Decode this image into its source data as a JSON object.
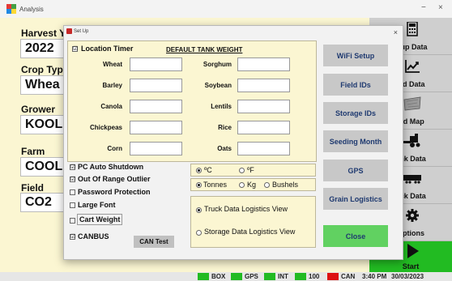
{
  "window": {
    "title": "Analysis",
    "minimize": "−",
    "close": "×"
  },
  "main": {
    "harvest_year": {
      "label": "Harvest Y",
      "value": "2022"
    },
    "crop_type": {
      "label": "Crop Type",
      "value": "Whea"
    },
    "grower": {
      "label": "Grower",
      "value": "KOOL"
    },
    "farm": {
      "label": "Farm",
      "value": "COOL"
    },
    "field": {
      "label": "Field",
      "value": "CO2"
    }
  },
  "sidebar": {
    "items": [
      {
        "label": "etup Data",
        "icon": "calculator-icon"
      },
      {
        "label": "eld Data",
        "icon": "chart-icon"
      },
      {
        "label": "eld Map",
        "icon": "map-icon"
      },
      {
        "label": "ank Data",
        "icon": "harvester-icon"
      },
      {
        "label": "uck Data",
        "icon": "truck-icon"
      },
      {
        "label": "Options",
        "icon": "gear-icon"
      },
      {
        "label": "Start",
        "icon": "play-icon"
      }
    ]
  },
  "status": {
    "items": [
      "BOX",
      "GPS",
      "INT",
      "100",
      "CAN"
    ],
    "time": "3:40 PM",
    "date": "30/03/2023",
    "colors": {
      "ok": "#22bb22",
      "bad": "#dd1111"
    }
  },
  "dialog": {
    "title": "Set Up",
    "close": "×",
    "location_timer": {
      "label": "Location Timer",
      "checked": "☑"
    },
    "tank_weight_heading": "DEFAULT TANK WEIGHT",
    "crops_left": [
      "Wheat",
      "Barley",
      "Canola",
      "Chickpeas",
      "Corn"
    ],
    "crops_right": [
      "Sorghum",
      "Soybean",
      "Lentils",
      "Rice",
      "Oats"
    ],
    "options": [
      {
        "label": "PC Auto Shutdown",
        "checked": "☑",
        "bold": true
      },
      {
        "label": "Out Of Range Outlier",
        "checked": "☑",
        "bold": true
      },
      {
        "label": "Password Protection",
        "checked": "",
        "bold": true
      },
      {
        "label": "Large Font",
        "checked": "",
        "bold": true
      },
      {
        "label": "Cart Weight",
        "checked": "",
        "bold": true
      },
      {
        "label": "CANBUS",
        "checked": "☑",
        "bold": true
      }
    ],
    "can_test": "CAN Test",
    "temperature": {
      "c": "ºC",
      "f": "ºF",
      "selected": "c"
    },
    "units": {
      "tonnes": "Tonnes",
      "kg": "Kg",
      "bushels": "Bushels",
      "selected": "tonnes"
    },
    "logistics": {
      "truck": "Truck Data Logistics View",
      "storage": "Storage Data Logistics View",
      "selected": "truck"
    },
    "buttons": [
      "WiFi Setup",
      "Field IDs",
      "Storage IDs",
      "Seeding Month",
      "GPS",
      "Grain Logistics"
    ],
    "close_button": "Close"
  }
}
